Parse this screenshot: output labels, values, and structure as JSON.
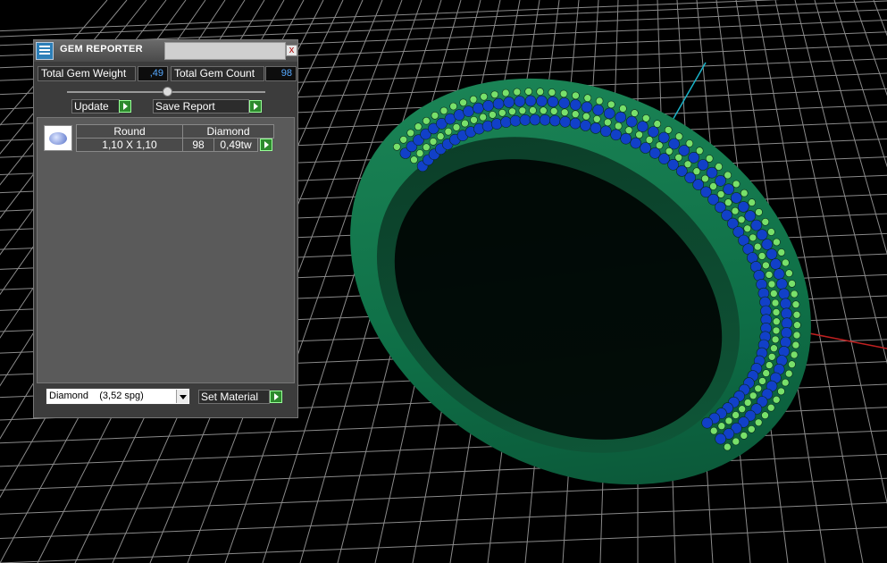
{
  "panel": {
    "title": "GEM REPORTER",
    "close_glyph": "x",
    "total_weight_label": "Total Gem Weight",
    "total_weight_value": ",49",
    "total_count_label": "Total Gem Count",
    "total_count_value": "98",
    "update_label": "Update",
    "save_report_label": "Save Report",
    "table": {
      "header": [
        "Round",
        "Diamond"
      ],
      "row": [
        "1,10 X 1,10",
        "98",
        "0,49tw"
      ]
    },
    "material_select_value": "Diamond    (3,52 spg)",
    "set_material_label": "Set Material"
  },
  "scene": {
    "ring_color": "#0e6e46",
    "gem_color": "#1140c8",
    "bead_color": "#78e06a",
    "axis_red": "#c02020",
    "axis_cyan": "#1ab3c8",
    "grid_color": "#9a9a9a"
  }
}
